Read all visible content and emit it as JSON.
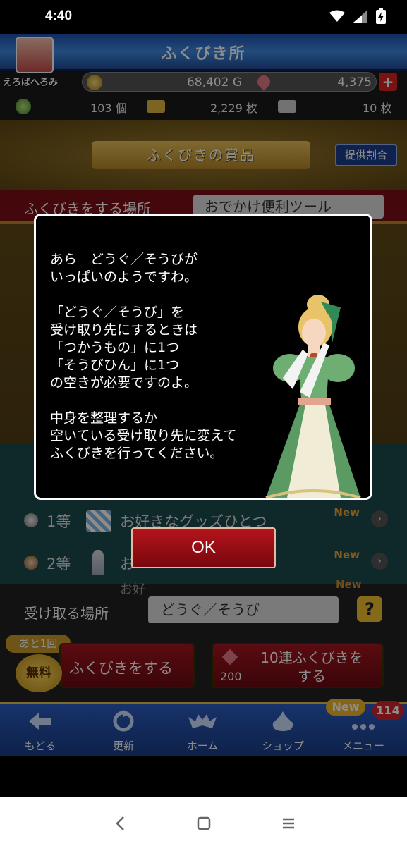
{
  "status_bar": {
    "time": "4:40"
  },
  "header": {
    "title": "ふくびき所"
  },
  "player": {
    "name": "えろばへろみ",
    "gold": "68,402 G",
    "gems": "4,375",
    "plus": "+",
    "item_count": "103 個",
    "ticket_gold": "2,229 枚",
    "ticket_silver": "10 枚"
  },
  "prize_section": {
    "title": "ふくびきの賞品",
    "odds_button": "提供割合"
  },
  "location": {
    "label": "ふくびきをする場所",
    "value": "おでかけ便利ツール"
  },
  "prize_list": [
    {
      "rank": "1等",
      "name": "お好きなグッズひとつ",
      "badge": "New"
    },
    {
      "rank": "2等",
      "name": "お",
      "badge": "New"
    },
    {
      "rank": "",
      "name": "お好",
      "badge": "New"
    }
  ],
  "receive": {
    "label": "受け取る場所",
    "value": "どうぐ／そうび",
    "help": "?"
  },
  "draw": {
    "remaining": "あと1回",
    "free_badge": "無料",
    "single_label": "ふくびきをする",
    "multi_label_line1": "10連ふくびきを",
    "multi_label_line2": "する",
    "multi_cost": "200"
  },
  "bottom_nav": {
    "items": [
      {
        "label": "もどる",
        "icon": "back-arrow-icon"
      },
      {
        "label": "更新",
        "icon": "refresh-icon"
      },
      {
        "label": "ホーム",
        "icon": "bat-home-icon"
      },
      {
        "label": "ショップ",
        "icon": "slime-shop-icon"
      },
      {
        "label": "メニュー",
        "icon": "menu-dots-icon"
      }
    ],
    "new_badge": "New",
    "count_badge": "114"
  },
  "dialog": {
    "lines": [
      "あら　どうぐ／そうびが",
      "いっぱいのようですわ。",
      "",
      "「どうぐ／そうび」を",
      "受け取り先にするときは",
      "「つかうもの」に1つ",
      "「そうびひん」に1つ",
      "の空きが必要ですのよ。",
      "",
      "中身を整理するか",
      "空いている受け取り先に変えて",
      "ふくびきを行ってください。"
    ],
    "ok_button": "OK"
  }
}
